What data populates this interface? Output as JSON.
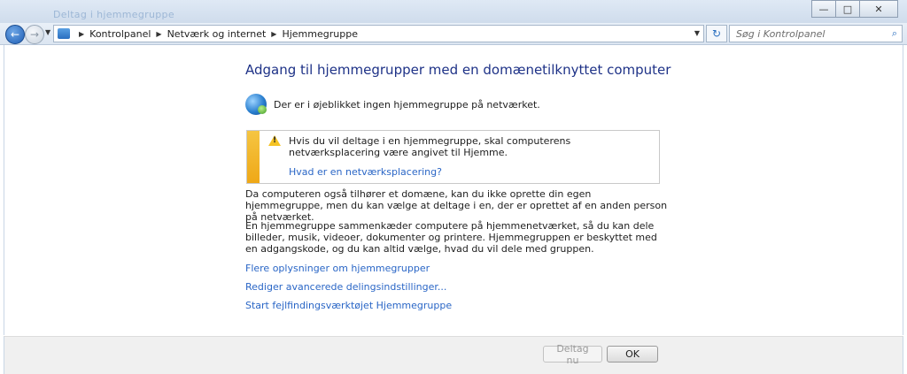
{
  "window": {
    "ghost_title": "Deltag i hjemmegruppe",
    "buttons": {
      "minimize": "—",
      "maximize": "□",
      "close": "✕"
    }
  },
  "nav": {
    "back_glyph": "←",
    "forward_glyph": "→",
    "breadcrumb": [
      "Kontrolpanel",
      "Netværk og internet",
      "Hjemmegruppe"
    ],
    "refresh_glyph": "↻",
    "search_placeholder": "Søg i Kontrolpanel",
    "search_icon": "search-icon"
  },
  "main": {
    "heading": "Adgang til hjemmegrupper med en domænetilknyttet computer",
    "status": "Der er i øjeblikket ingen hjemmegruppe på netværket.",
    "warning": {
      "text": "Hvis du vil deltage i en hjemmegruppe, skal computerens netværksplacering være angivet til Hjemme.",
      "link": "Hvad er en netværksplacering?",
      "bar_color": "#f0ac1c"
    },
    "paragraph1": "Da computeren også tilhører et domæne, kan du ikke oprette din egen hjemmegruppe, men du kan vælge at deltage i en, der er oprettet af en anden person på netværket.",
    "paragraph2": "En hjemmegruppe sammenkæder computere på hjemmenetværket, så du kan dele billeder, musik, videoer, dokumenter og printere. Hjemmegruppen er beskyttet med en adgangskode, og du kan altid vælge, hvad du vil dele med gruppen.",
    "links": [
      "Flere oplysninger om hjemmegrupper",
      "Rediger avancerede delingsindstillinger...",
      "Start fejlfindingsværktøjet Hjemmegruppe"
    ]
  },
  "footer": {
    "join_label": "Deltag nu",
    "ok_label": "OK"
  }
}
